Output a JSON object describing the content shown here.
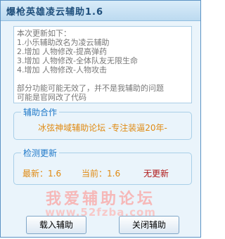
{
  "window": {
    "title": "爆枪英雄凌云辅助1.6"
  },
  "notes": {
    "lines": [
      "本次更新如下：",
      "1.小乐辅助改名为凌云辅助",
      "2.增加 人物修改-提高弹药",
      "3.增加 人物修改-全体队友无限生命",
      "4.增加 人物修改-人物攻击"
    ],
    "footer": [
      "部分功能可能无效了，并不是我辅助的问题",
      "可能是官网改了代码"
    ]
  },
  "cooperation": {
    "title": "辅助合作",
    "text": "冰弦神域辅助论坛  -专注装逼20年-"
  },
  "update": {
    "title": "检测更新",
    "latest_label": "最新：",
    "latest_value": "1.6",
    "current_label": "当前：",
    "current_value": "1.6",
    "status": "无更新"
  },
  "watermark": {
    "line1": "我爱辅助论坛",
    "line2": "www.52fzba.com"
  },
  "buttons": {
    "load": "载入辅助",
    "close": "关闭辅助"
  }
}
